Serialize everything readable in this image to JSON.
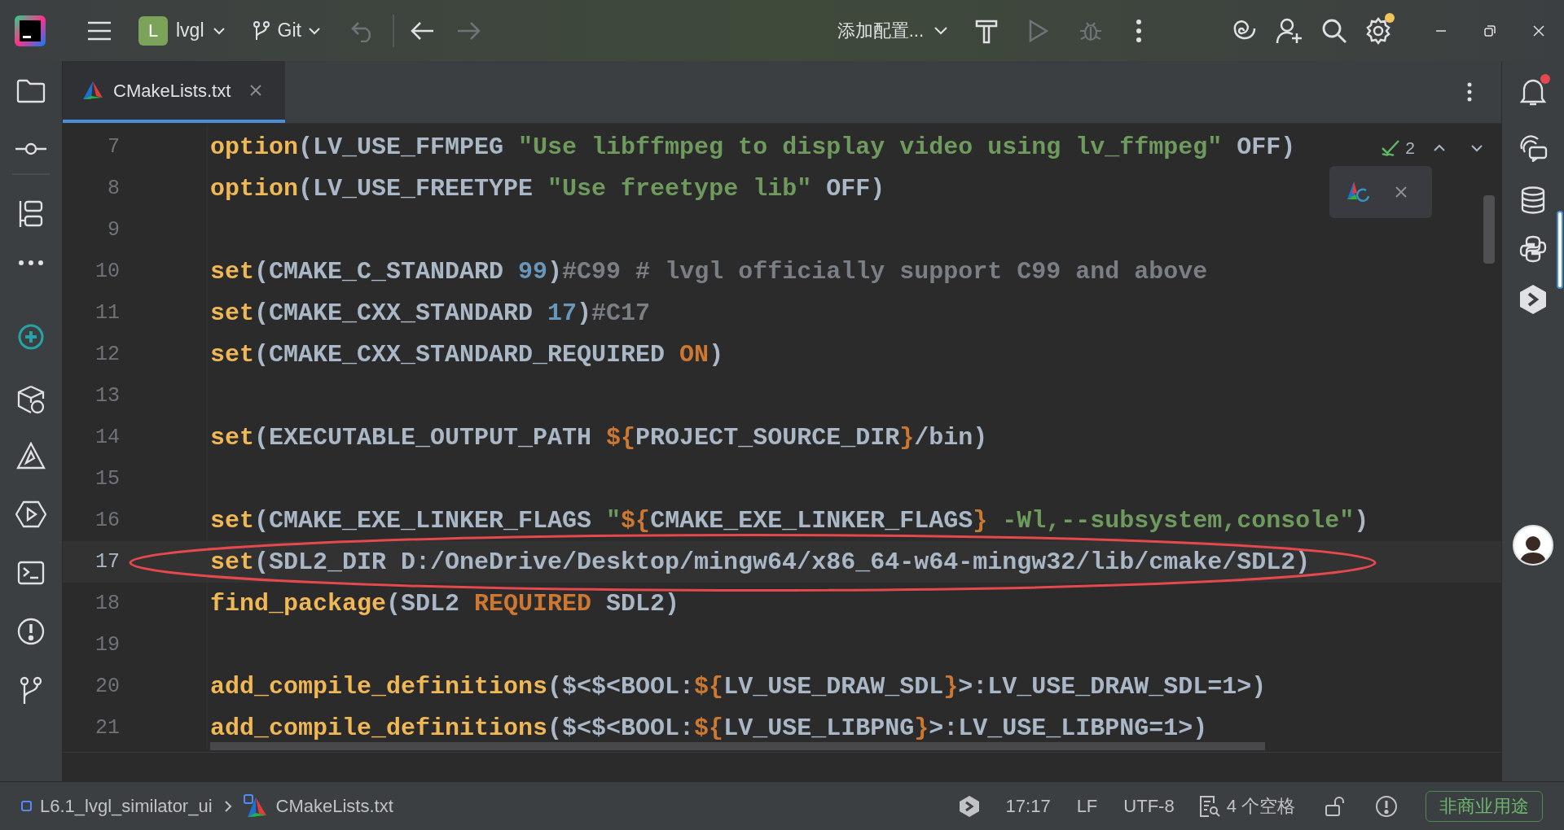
{
  "toolbar": {
    "project_initial": "L",
    "project": "lvgl",
    "vcs": "Git",
    "run_config": "添加配置...",
    "settings_badge": true
  },
  "tabs": [
    {
      "label": "CMakeLists.txt",
      "selected": true
    }
  ],
  "editor": {
    "inspection": {
      "count": "2"
    },
    "lines": [
      {
        "number": "7",
        "current": false,
        "tokens": [
          {
            "kind": "keyword",
            "text": "option"
          },
          {
            "kind": "plain",
            "text": "(LV_USE_FFMPEG "
          },
          {
            "kind": "string",
            "text": "\"Use libffmpeg to display video using lv_ffmpeg\""
          },
          {
            "kind": "plain",
            "text": " OFF)"
          }
        ]
      },
      {
        "number": "8",
        "current": false,
        "tokens": [
          {
            "kind": "keyword",
            "text": "option"
          },
          {
            "kind": "plain",
            "text": "(LV_USE_FREETYPE "
          },
          {
            "kind": "string",
            "text": "\"Use freetype lib\""
          },
          {
            "kind": "plain",
            "text": " OFF)"
          }
        ]
      },
      {
        "number": "9",
        "current": false
      },
      {
        "number": "10",
        "current": false,
        "tokens": [
          {
            "kind": "keyword",
            "text": "set"
          },
          {
            "kind": "plain",
            "text": "(CMAKE_C_STANDARD "
          },
          {
            "kind": "number",
            "text": "99"
          },
          {
            "kind": "plain",
            "text": ")"
          },
          {
            "kind": "comment",
            "text": "#C99 # lvgl officially support C99 and above"
          }
        ]
      },
      {
        "number": "11",
        "current": false,
        "tokens": [
          {
            "kind": "keyword",
            "text": "set"
          },
          {
            "kind": "plain",
            "text": "(CMAKE_CXX_STANDARD "
          },
          {
            "kind": "number",
            "text": "17"
          },
          {
            "kind": "plain",
            "text": ")"
          },
          {
            "kind": "comment",
            "text": "#C17"
          }
        ]
      },
      {
        "number": "12",
        "current": false,
        "tokens": [
          {
            "kind": "keyword",
            "text": "set"
          },
          {
            "kind": "plain",
            "text": "(CMAKE_CXX_STANDARD_REQUIRED "
          },
          {
            "kind": "constant",
            "text": "ON"
          },
          {
            "kind": "plain",
            "text": ")"
          }
        ]
      },
      {
        "number": "13",
        "current": false
      },
      {
        "number": "14",
        "current": false,
        "tokens": [
          {
            "kind": "keyword",
            "text": "set"
          },
          {
            "kind": "plain",
            "text": "(EXECUTABLE_OUTPUT_PATH "
          },
          {
            "kind": "variable",
            "text": "${"
          },
          {
            "kind": "plain",
            "text": "PROJECT_SOURCE_DIR"
          },
          {
            "kind": "variable",
            "text": "}"
          },
          {
            "kind": "plain",
            "text": "/bin)"
          }
        ]
      },
      {
        "number": "15",
        "current": false
      },
      {
        "number": "16",
        "current": false,
        "tokens": [
          {
            "kind": "keyword",
            "text": "set"
          },
          {
            "kind": "plain",
            "text": "(CMAKE_EXE_LINKER_FLAGS "
          },
          {
            "kind": "string",
            "text": "\""
          },
          {
            "kind": "variable",
            "text": "${"
          },
          {
            "kind": "plain",
            "text": "CMAKE_EXE_LINKER_FLAGS"
          },
          {
            "kind": "variable",
            "text": "}"
          },
          {
            "kind": "string",
            "text": " -Wl,--subsystem,console\""
          },
          {
            "kind": "plain",
            "text": ")"
          }
        ]
      },
      {
        "number": "17",
        "current": true,
        "tokens": [
          {
            "kind": "keyword",
            "text": "set"
          },
          {
            "kind": "plain",
            "text": "(SDL2_DIR D:/OneDrive/Desktop/mingw64/x86_64-w64-mingw32/lib/cmake/SDL2)"
          }
        ]
      },
      {
        "number": "18",
        "current": false,
        "tokens": [
          {
            "kind": "keyword",
            "text": "find_package"
          },
          {
            "kind": "plain",
            "text": "(SDL2 "
          },
          {
            "kind": "constant",
            "text": "REQUIRED"
          },
          {
            "kind": "plain",
            "text": " SDL2)"
          }
        ]
      },
      {
        "number": "19",
        "current": false
      },
      {
        "number": "20",
        "current": false,
        "tokens": [
          {
            "kind": "keyword",
            "text": "add_compile_definitions"
          },
          {
            "kind": "plain",
            "text": "($<$<BOOL:"
          },
          {
            "kind": "variable",
            "text": "${"
          },
          {
            "kind": "plain",
            "text": "LV_USE_DRAW_SDL"
          },
          {
            "kind": "variable",
            "text": "}"
          },
          {
            "kind": "plain",
            "text": ">:LV_USE_DRAW_SDL=1>)"
          }
        ]
      },
      {
        "number": "21",
        "current": false,
        "tokens": [
          {
            "kind": "keyword",
            "text": "add_compile_definitions"
          },
          {
            "kind": "plain",
            "text": "($<$<BOOL:"
          },
          {
            "kind": "variable",
            "text": "${"
          },
          {
            "kind": "plain",
            "text": "LV_USE_LIBPNG"
          },
          {
            "kind": "variable",
            "text": "}"
          },
          {
            "kind": "plain",
            "text": ">:LV_USE_LIBPNG=1>)"
          }
        ]
      }
    ],
    "annotation": {
      "kind": "ellipse"
    }
  },
  "right_sidebar": {
    "notifications_badge": true,
    "items": [
      {
        "kind": "chat",
        "selected": false
      },
      {
        "kind": "database",
        "selected": false
      },
      {
        "kind": "python",
        "selected": true
      },
      {
        "kind": "hexagon",
        "selected": false
      }
    ]
  },
  "status_bar": {
    "breadcrumbs": [
      "L6.1_lvgl_similator_ui",
      "CMakeLists.txt"
    ],
    "caret": "17:17",
    "line_ending": "LF",
    "encoding": "UTF-8",
    "indent": "4 个空格",
    "license": "非商业用途"
  }
}
